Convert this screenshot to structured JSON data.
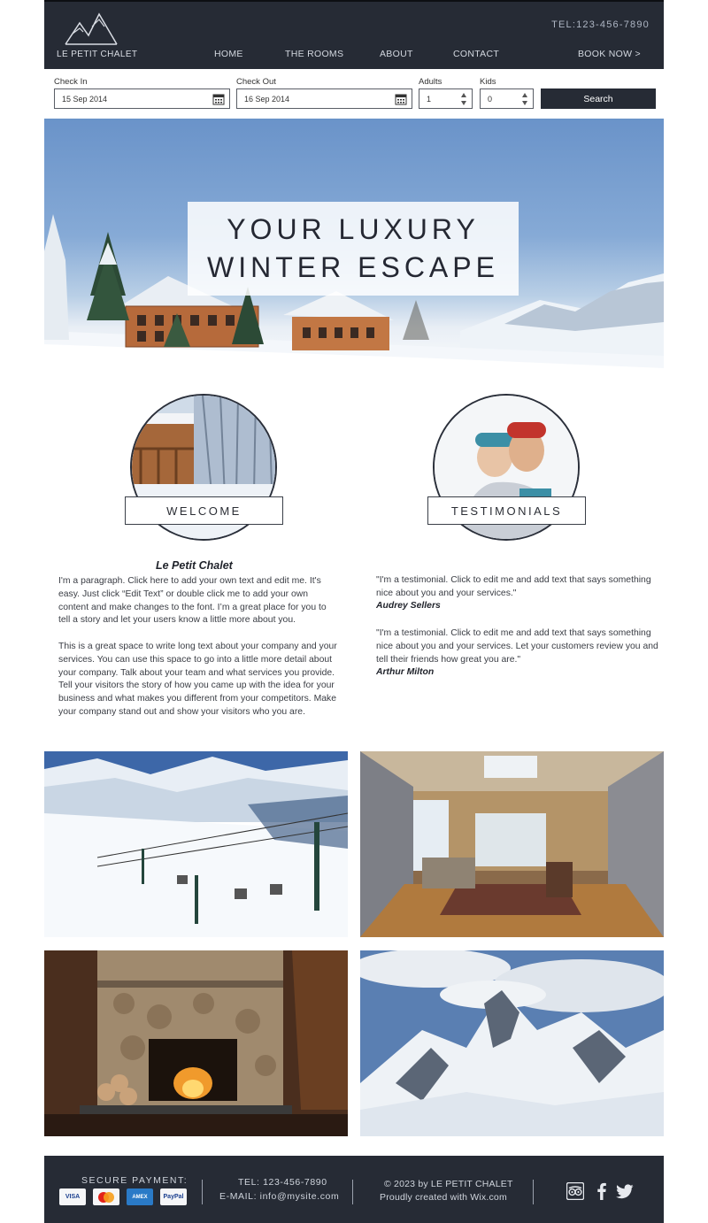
{
  "header": {
    "logo_text": "LE PETIT CHALET",
    "tel": "TEL:123-456-7890",
    "nav": [
      "HOME",
      "THE ROOMS",
      "ABOUT",
      "CONTACT",
      "BOOK NOW >"
    ]
  },
  "booking": {
    "check_in_label": "Check In",
    "check_in_value": "15 Sep 2014",
    "check_out_label": "Check Out",
    "check_out_value": "16 Sep 2014",
    "adults_label": "Adults",
    "adults_value": "1",
    "kids_label": "Kids",
    "kids_value": "0",
    "search_label": "Search"
  },
  "hero": {
    "line1": "YOUR LUXURY",
    "line2": "WINTER ESCAPE"
  },
  "sections": {
    "welcome_label": "WELCOME",
    "testimonials_label": "TESTIMONIALS"
  },
  "welcome": {
    "title": "Le Petit Chalet",
    "paragraph1": "I'm a paragraph. Click here to add your own text and edit me. It's easy. Just click “Edit Text” or double click me to add your own content and make changes to the font. I’m a great place for you to tell a story and let your users know a little more about you.",
    "paragraph2": "This is a great space to write long text about your company and your services. You can use this space to go into a little more detail about your company. Talk about your team and what services you provide. Tell your visitors the story of how you came up with the idea for your business and what makes you different from your competitors. Make your company stand out and show your visitors who you are."
  },
  "testimonials": [
    {
      "quote": "\"I'm a testimonial. Click to edit me and add text that says something nice about you and your services.\"",
      "author": "Audrey Sellers"
    },
    {
      "quote": "\"I'm a testimonial. Click to edit me and add text that says something nice about you and your services.  Let your customers review you and tell their friends how great you are.\"",
      "author": "Arthur Milton"
    }
  ],
  "footer": {
    "secure_payment": "SECURE PAYMENT:",
    "tel": "TEL: 123-456-7890",
    "email_label": "E-MAIL: ",
    "email": "info@mysite.com",
    "copyright": "© 2023 by  LE PETIT CHALET",
    "created_with": "Proudly created with Wix.com",
    "cards": [
      "VISA",
      "MC",
      "AMEX",
      "PayPal"
    ]
  },
  "icons": {
    "calendar": "calendar-icon",
    "spinner": "stepper-icon",
    "tripadvisor": "tripadvisor-icon",
    "facebook": "facebook-icon",
    "twitter": "twitter-icon",
    "logo": "mountain-logo-icon"
  },
  "colors": {
    "header_bg": "#262b35",
    "footer_bg": "#262b35",
    "button_bg": "#262b35"
  }
}
